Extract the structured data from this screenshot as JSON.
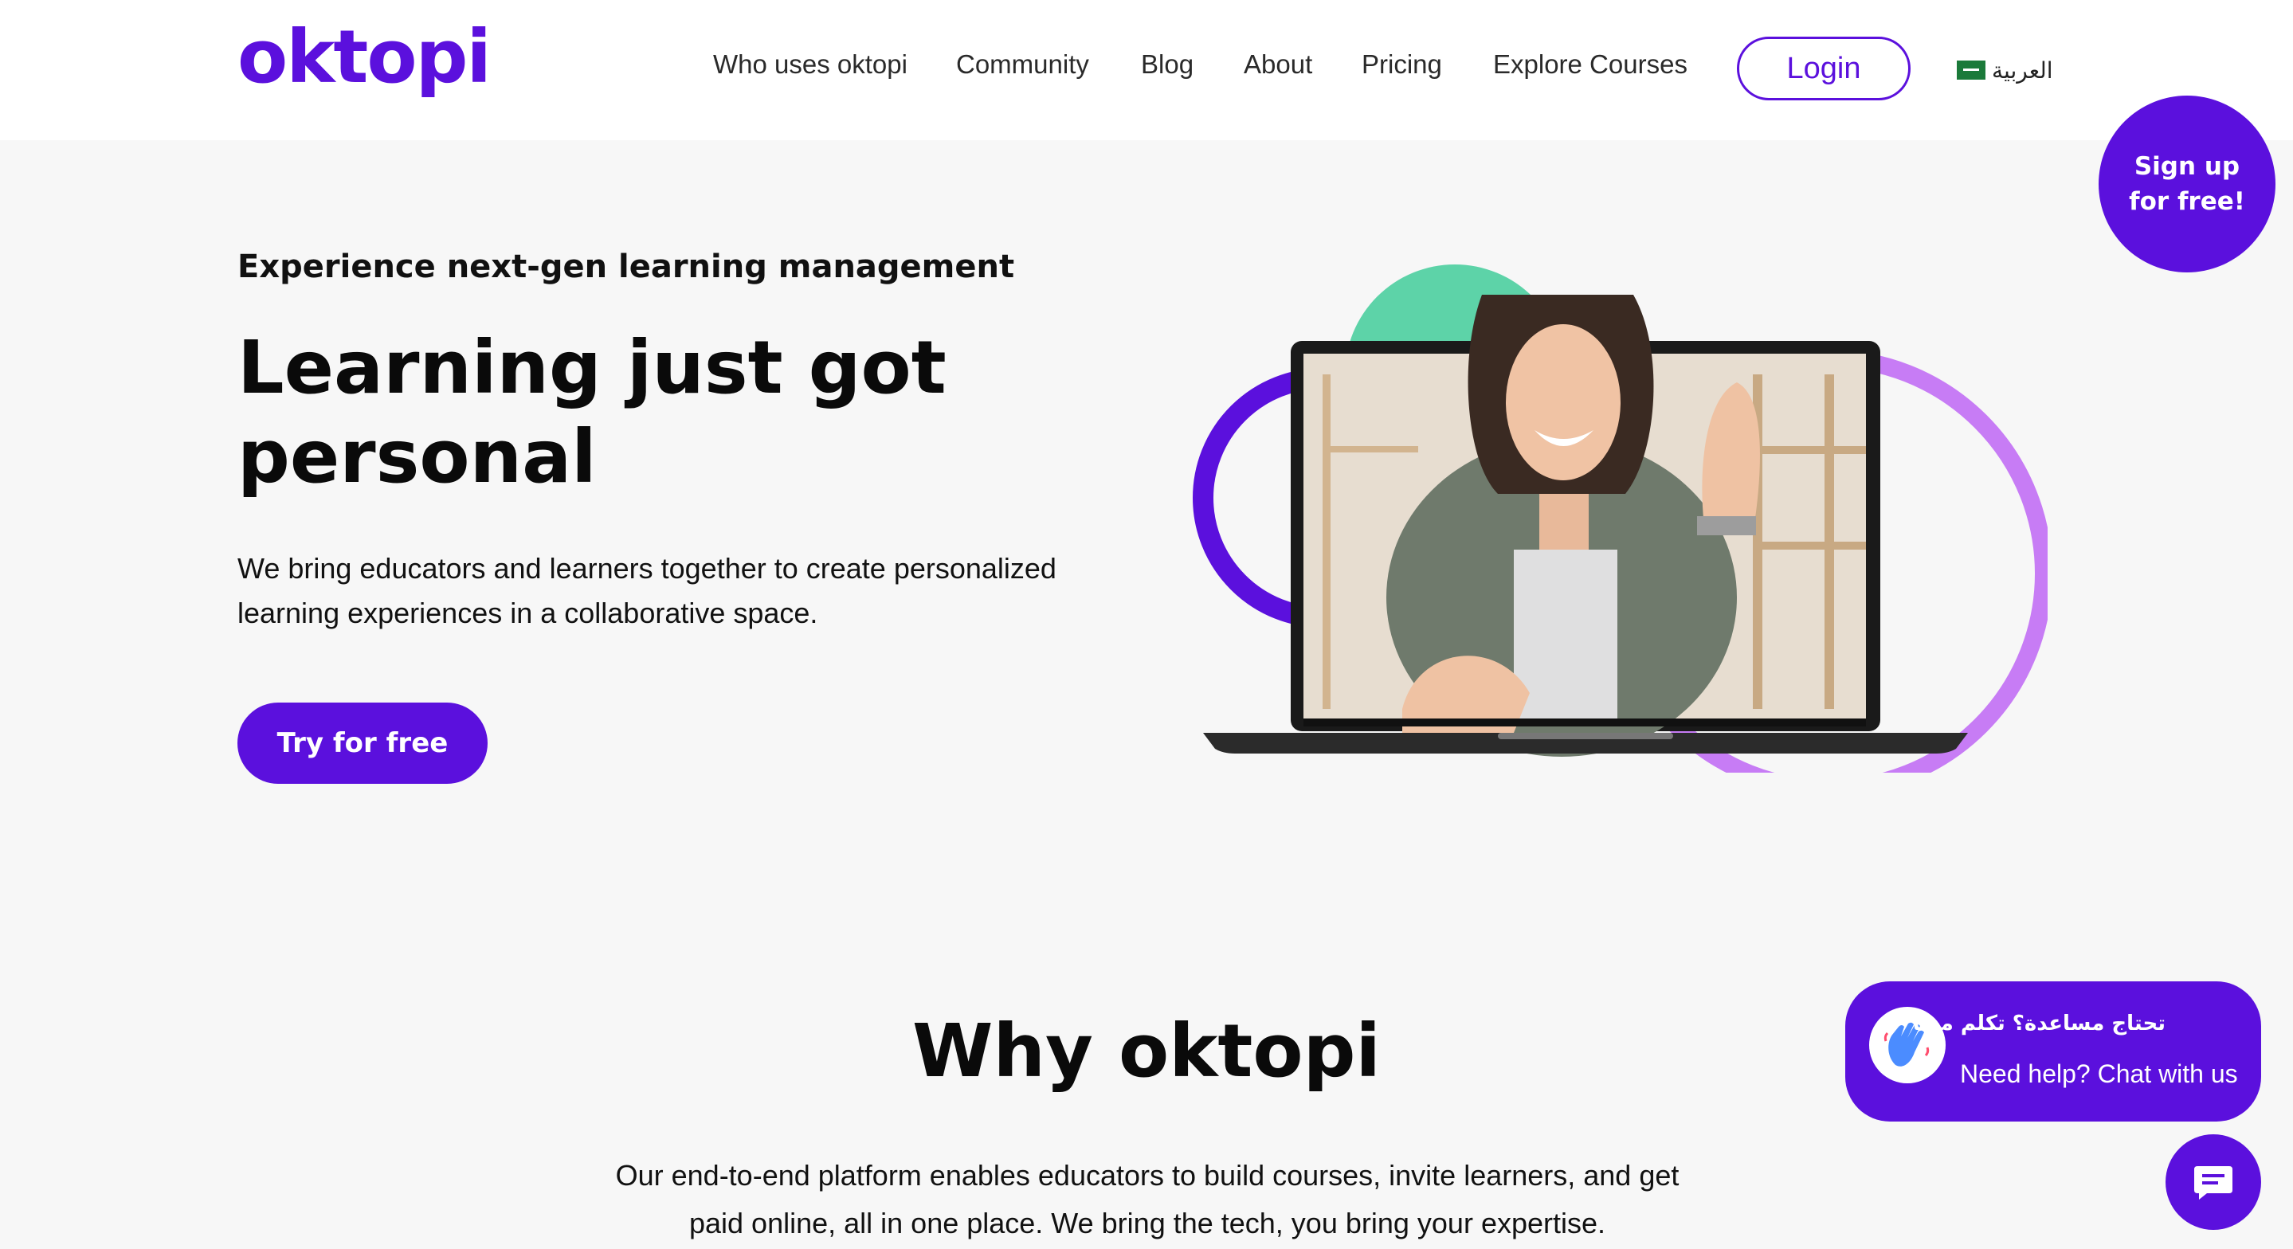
{
  "brand": {
    "logo": "oktopi",
    "accent": "#5b10dd"
  },
  "nav": {
    "items": [
      {
        "label": "Who uses oktopi"
      },
      {
        "label": "Community"
      },
      {
        "label": "Blog"
      },
      {
        "label": "About"
      },
      {
        "label": "Pricing"
      },
      {
        "label": "Explore Courses"
      }
    ],
    "login": "Login",
    "language": "العربية"
  },
  "signup": {
    "label": "Sign up for free!"
  },
  "hero": {
    "eyebrow": "Experience next-gen learning management",
    "title": "Learning just got personal",
    "description": "We bring educators and learners together to create personalized learning experiences in a collaborative space.",
    "cta": "Try for free"
  },
  "why": {
    "title": "Why oktopi",
    "description": "Our end-to-end platform enables educators to build courses, invite learners, and get paid online, all in one place. We bring the tech, you bring your expertise."
  },
  "chat": {
    "arabic": "تحتاج مساعدة؟ تكلم معنا",
    "english": "Need help? Chat with us",
    "icons": [
      "waving-hand-icon",
      "chat-icon"
    ]
  },
  "colors": {
    "primary": "#5b10dd",
    "green": "#5dd3a8",
    "light_purple": "#c77cf5",
    "background": "#f7f7f7"
  }
}
